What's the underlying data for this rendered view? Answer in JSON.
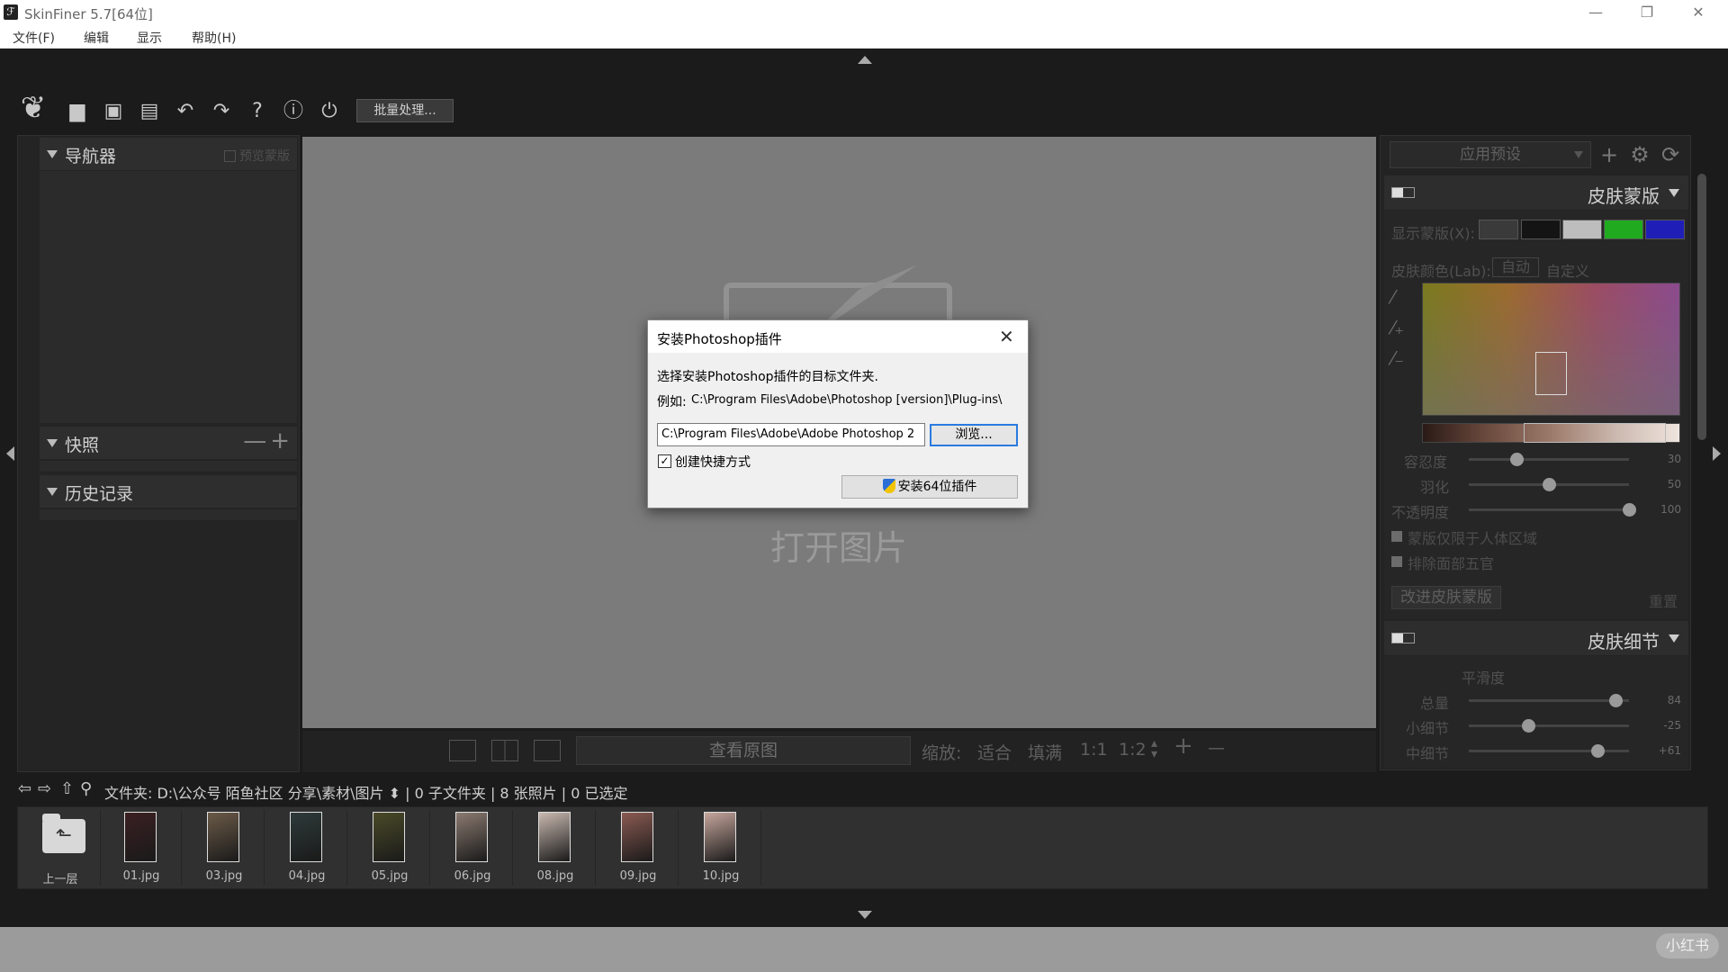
{
  "window": {
    "title": "SkinFiner 5.7[64位]",
    "minimize": "—",
    "restore": "❐",
    "close": "✕"
  },
  "menu": [
    {
      "label": "文件(F)"
    },
    {
      "label": "编辑"
    },
    {
      "label": "显示"
    },
    {
      "label": "帮助(H)"
    }
  ],
  "toolbar": {
    "batch_label": "批量处理...",
    "icons": [
      "leaf-logo-icon",
      "folder-open-icon",
      "save-icon",
      "save-as-icon",
      "undo-icon",
      "redo-icon",
      "help-icon",
      "info-icon",
      "plugin-icon"
    ]
  },
  "left_panel": {
    "navigator": {
      "title": "导航器",
      "preview_mask": "预览蒙版"
    },
    "snapshot": {
      "title": "快照",
      "remove": "—",
      "add": "+"
    },
    "history": {
      "title": "历史记录"
    }
  },
  "canvas": {
    "open_image": "打开图片",
    "view_original": "查看原图",
    "zoom_label": "缩放:",
    "zoom_fit": "适合",
    "zoom_fill": "填满",
    "zoom_1_1": "1:1",
    "zoom_1_2": "1:2",
    "zoom_in": "+",
    "zoom_out": "—"
  },
  "right_panel": {
    "preset": {
      "label": "应用预设"
    },
    "skin_mask": {
      "title": "皮肤蒙版",
      "show_mask": "显示蒙版(X):",
      "swatches": [
        "#3a3a3a",
        "#141414",
        "#bdbdbd",
        "#1faa1f",
        "#1f1fb8"
      ],
      "skin_color": "皮肤颜色(Lab):",
      "auto": "自动",
      "custom": "自定义",
      "sliders": [
        {
          "label": "容忍度",
          "value": 30,
          "max": 100
        },
        {
          "label": "羽化",
          "value": 50,
          "max": 100
        },
        {
          "label": "不透明度",
          "value": 100,
          "max": 100
        }
      ],
      "checks": [
        {
          "label": "蒙版仅限于人体区域",
          "checked": true
        },
        {
          "label": "排除面部五官",
          "checked": true
        }
      ],
      "improve": "改进皮肤蒙版",
      "reset": "重置"
    },
    "skin_detail": {
      "title": "皮肤细节",
      "smoothness": "平滑度",
      "sliders": [
        {
          "label": "总量",
          "value": 84,
          "display": "84",
          "min": -100,
          "max": 100
        },
        {
          "label": "小细节",
          "value": -25,
          "display": "-25",
          "min": -100,
          "max": 100
        },
        {
          "label": "中细节",
          "value": 61,
          "display": "+61",
          "min": -100,
          "max": 100
        }
      ]
    }
  },
  "pathbar": {
    "text": "文件夹:  D:\\公众号 陌鱼社区 分享\\素材\\图片 ⬍ | 0 子文件夹 | 8 张照片 | 0 已选定"
  },
  "filmstrip": {
    "up_label": "上一层",
    "files": [
      {
        "name": "01.jpg",
        "color": "#3a1f22"
      },
      {
        "name": "03.jpg",
        "color": "#6b5a48"
      },
      {
        "name": "04.jpg",
        "color": "#2e3a3a"
      },
      {
        "name": "05.jpg",
        "color": "#4a4a28"
      },
      {
        "name": "06.jpg",
        "color": "#8a7a70"
      },
      {
        "name": "08.jpg",
        "color": "#c9b9b0"
      },
      {
        "name": "09.jpg",
        "color": "#8a5a52"
      },
      {
        "name": "10.jpg",
        "color": "#c6a69c"
      }
    ]
  },
  "dialog": {
    "title": "安装Photoshop插件",
    "close": "✕",
    "description": "选择安装Photoshop插件的目标文件夹.",
    "example_label": "例如:",
    "example_path": "C:\\Program Files\\Adobe\\Photoshop [version]\\Plug-ins\\",
    "input_value": "C:\\Program Files\\Adobe\\Adobe Photoshop 2",
    "browse": "浏览...",
    "create_shortcut": "创建快捷方式",
    "install": "安装64位插件"
  },
  "watermark": "小红书"
}
